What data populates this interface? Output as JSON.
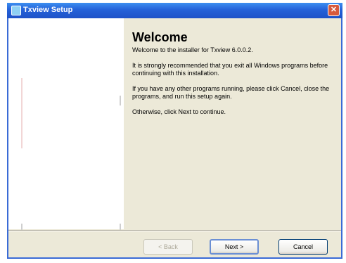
{
  "window": {
    "title": "Txview Setup",
    "close_symbol": "✕"
  },
  "icons": {
    "app": "installer-app-icon",
    "close": "close-icon"
  },
  "main": {
    "heading": "Welcome",
    "paragraphs": [
      "Welcome to the installer for Txview 6.0.0.2.",
      "It is strongly recommended that you exit all Windows programs before continuing with this installation.",
      "If you have any other programs running, please click Cancel, close the programs, and run this setup again.",
      "Otherwise, click Next to continue."
    ]
  },
  "buttons": {
    "back": "< Back",
    "next": "Next >",
    "cancel": "Cancel"
  },
  "colors": {
    "title_bar": "#2461d8",
    "window_bg": "#ece9d8",
    "banner_bg": "#ffffff"
  }
}
